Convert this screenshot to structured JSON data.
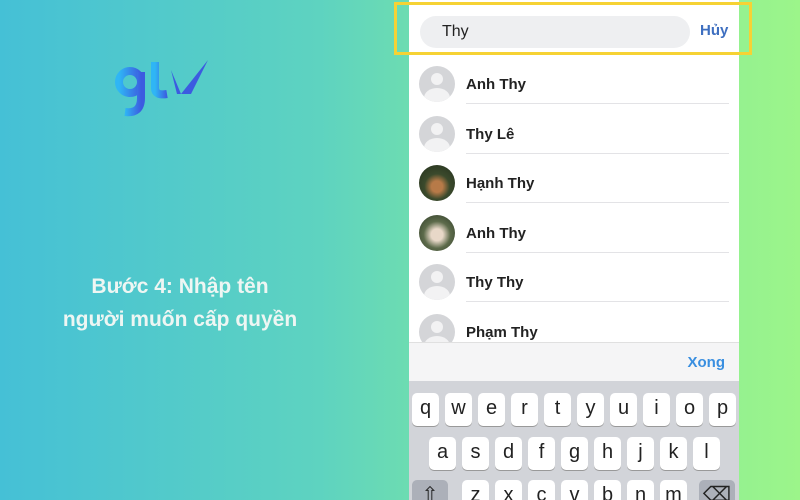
{
  "logo": {
    "text": "gtv",
    "colors": [
      "#2fb6f5",
      "#3c5be0"
    ]
  },
  "caption": {
    "line1": "Bước 4: Nhập tên",
    "line2": "người muốn cấp quyền"
  },
  "search": {
    "value": "Thy",
    "cancel_label": "Hủy"
  },
  "contacts": [
    {
      "name": "Anh Thy",
      "avatar": "default"
    },
    {
      "name": "Thy Lê",
      "avatar": "default"
    },
    {
      "name": "Hạnh Thy",
      "avatar": "photo"
    },
    {
      "name": "Anh Thy",
      "avatar": "photo"
    },
    {
      "name": "Thy Thy",
      "avatar": "default"
    },
    {
      "name": "Phạm Thy",
      "avatar": "default"
    }
  ],
  "toolbar": {
    "done_label": "Xong"
  },
  "keyboard": {
    "row1": [
      "q",
      "w",
      "e",
      "r",
      "t",
      "y",
      "u",
      "i",
      "o",
      "p"
    ],
    "row2": [
      "a",
      "s",
      "d",
      "f",
      "g",
      "h",
      "j",
      "k",
      "l"
    ],
    "row3": [
      "z",
      "x",
      "c",
      "v",
      "b",
      "n",
      "m"
    ]
  },
  "colors": {
    "highlight": "#f6d234",
    "link": "#3e6fc0"
  }
}
